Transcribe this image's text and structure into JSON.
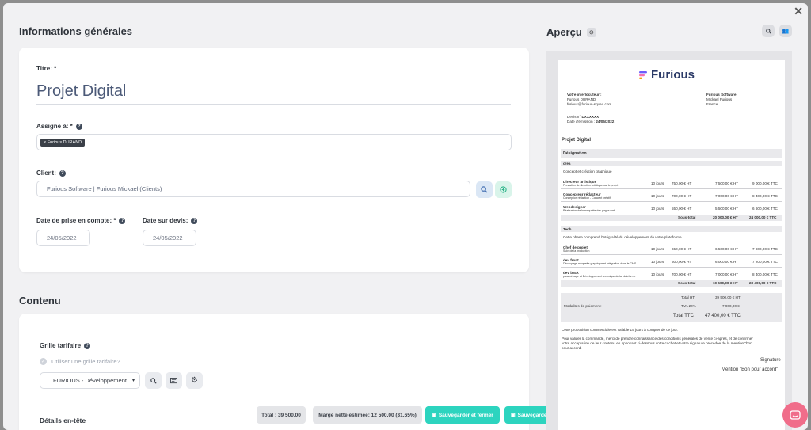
{
  "left": {
    "general_title": "Informations générales",
    "titre_label": "Titre: *",
    "titre_value": "Projet Digital",
    "assigne_label": "Assigné à: *",
    "assigne_tag": "× Furious DURAND",
    "client_label": "Client:",
    "client_value": "Furious Software  | Furious Mickael (Clients)",
    "date_prise_label": "Date de prise en compte: *",
    "date_prise_value": "24/05/2022",
    "date_devis_label": "Date sur devis:",
    "date_devis_value": "24/05/2022",
    "contenu_title": "Contenu",
    "grille_label": "Grille tarifaire",
    "utiliser_grille": "Utiliser une grille tarifaire?",
    "grille_select": "FURIOUS - Développement",
    "details_title": "Détails en-tête"
  },
  "footer": {
    "total": "Total : 39 500,00",
    "marge": "Marge nette estimée: 12 500,00 (31,65%)",
    "save_close": "Sauvegarder et fermer",
    "save": "Sauvegarder"
  },
  "preview": {
    "title": "Aperçu",
    "brand": "Furious",
    "interlocuteur_label": "Votre interlocuteur :",
    "interlocuteur_name": "Furious DURAND",
    "interlocuteur_email": "furious@furious-squad.com",
    "company_name": "Furious Software",
    "company_contact": "Mickael Furious",
    "company_country": "France",
    "devis_label": "Devis n°",
    "devis_number": "DXXXXXX",
    "emission_label": "Date d'émission :",
    "emission_date": "24/05/2022",
    "project_title": "Projet Digital",
    "designation": "Désignation",
    "groups": [
      {
        "name": "crea",
        "desc": "Concept et création graphique",
        "lines": [
          {
            "title": "Directeur artistique",
            "sub": "Prestation de direction artistique sur le projet",
            "qty": "10 jours",
            "unit": "750,00 € HT",
            "ht": "7 500,00 € HT",
            "ttc": "9 000,00 € TTC"
          },
          {
            "title": "Concepteur rédacteur",
            "sub": "Conception rédaction - Concept créatif",
            "qty": "10 jours",
            "unit": "700,00 € HT",
            "ht": "7 000,00 € HT",
            "ttc": "8 400,00 € TTC"
          },
          {
            "title": "Webdesigner",
            "sub": "Réalisation de la maquette des pages web",
            "qty": "10 jours",
            "unit": "550,00 € HT",
            "ht": "5 500,00 € HT",
            "ttc": "6 600,00 € TTC"
          }
        ],
        "subtotal_label": "Sous-total",
        "subtotal_ht": "20 000,00 € HT",
        "subtotal_ttc": "24 000,00 € TTC"
      },
      {
        "name": "Tech",
        "desc": "Cette phase comprend l'intégralité du développement de votre plateforme",
        "lines": [
          {
            "title": "Chef de projet",
            "sub": "Suivi de la production",
            "qty": "10 jours",
            "unit": "650,00 € HT",
            "ht": "6 500,00 € HT",
            "ttc": "7 800,00 € TTC"
          },
          {
            "title": "dev front",
            "sub": "Découpage maquette graphique et intégration dans le CMS",
            "qty": "10 jours",
            "unit": "600,00 € HT",
            "ht": "6 000,00 € HT",
            "ttc": "7 200,00 € TTC"
          },
          {
            "title": "dev back",
            "sub": "paramétrage et Développement technique de la plateforme",
            "qty": "10 jours",
            "unit": "700,00 € HT",
            "ht": "7 000,00 € HT",
            "ttc": "8 400,00 € TTC"
          }
        ],
        "subtotal_label": "Sous-total",
        "subtotal_ht": "19 500,00 € HT",
        "subtotal_ttc": "23 400,00 € TTC"
      }
    ],
    "total_ht_label": "Total HT",
    "total_ht": "39 500,00 € HT",
    "tva_label": "TVA 20%",
    "tva": "7 900,00 €",
    "total_ttc_label": "Total TTC",
    "total_ttc": "47 400,00 € TTC",
    "modalites": "Modalités de paiement:",
    "validity": "Cette proposition commerciale est valable 15 jours à compter de ce jour.",
    "terms_1": "Pour valider la commande, merci de prendre connaissance des conditions générales de vente ci-après, et de confirmer",
    "terms_2": "votre acceptation de leur contenu en apposant ci-dessous votre cachet et votre signature précédée de la mention \"bon",
    "terms_3": "pour accord.",
    "signature": "Signature",
    "mention": "Mention \"Bon pour accord\""
  },
  "colors": {
    "accent": "#2dd4bf",
    "brand_navy": "#2b3a67",
    "chat": "#f06d8a"
  }
}
